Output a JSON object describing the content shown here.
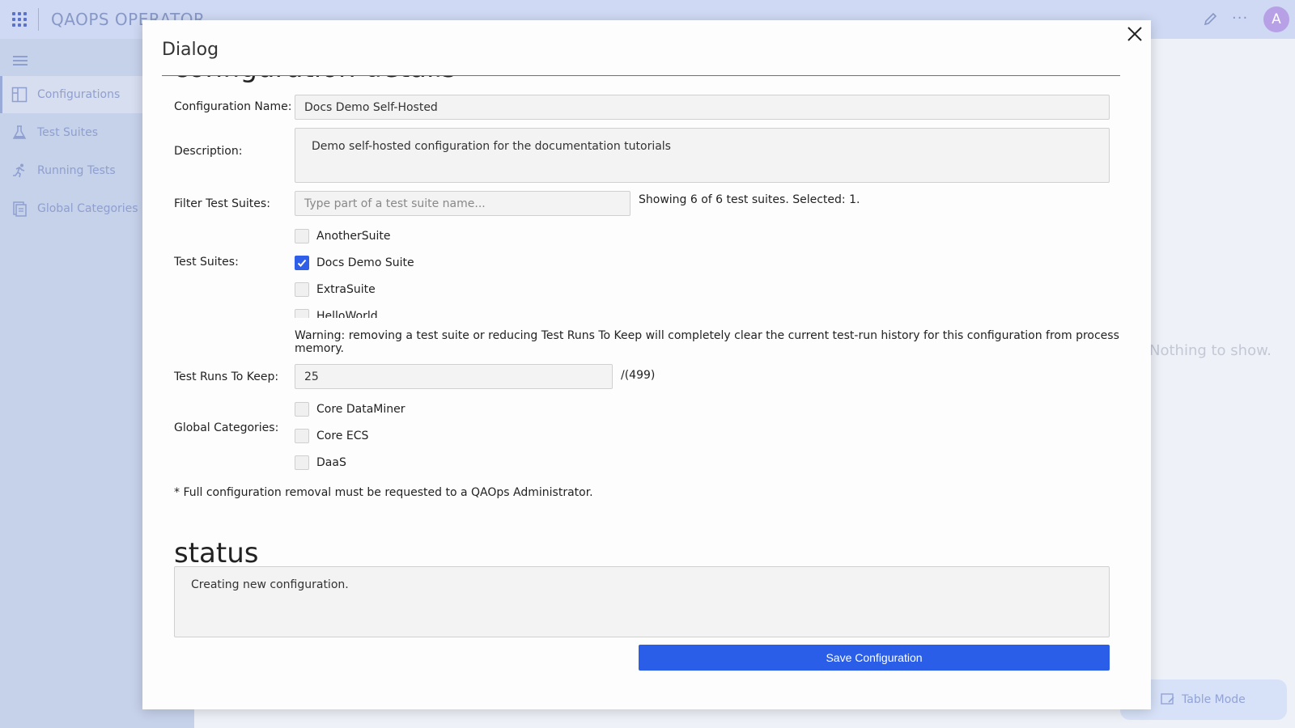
{
  "app": {
    "title": "QAOPS OPERATOR",
    "avatar_letter": "A",
    "more_glyph": "···"
  },
  "sidebar": {
    "items": [
      {
        "label": "Configurations",
        "icon": "layout-icon",
        "active": true
      },
      {
        "label": "Test Suites",
        "icon": "flask-icon",
        "active": false
      },
      {
        "label": "Running Tests",
        "icon": "runner-icon",
        "active": false
      },
      {
        "label": "Global Categories",
        "icon": "document-icon",
        "active": false
      }
    ]
  },
  "main": {
    "empty_text": "Nothing to show.",
    "table_mode_label": "Table Mode"
  },
  "dialog": {
    "title": "Dialog",
    "section_heading": "configuration details",
    "config_name": {
      "label": "Configuration Name:",
      "value": "Docs Demo Self-Hosted"
    },
    "description": {
      "label": "Description:",
      "value": "Demo self-hosted configuration for the documentation tutorials"
    },
    "filter": {
      "label": "Filter Test Suites:",
      "placeholder": "Type part of a test suite name...",
      "info": "Showing 6 of 6 test suites. Selected: 1."
    },
    "test_suites": {
      "label": "Test Suites:",
      "items": [
        {
          "label": "AnotherSuite",
          "checked": false
        },
        {
          "label": "Docs Demo Suite",
          "checked": true
        },
        {
          "label": "ExtraSuite",
          "checked": false
        },
        {
          "label": "HelloWorld",
          "checked": false
        }
      ]
    },
    "warning": "Warning: removing a test suite or reducing Test Runs To Keep will completely clear the current test-run history for this configuration from process memory.",
    "runs_to_keep": {
      "label": "Test Runs To Keep:",
      "value": "25",
      "max": "/(499)"
    },
    "global_categories": {
      "label": "Global Categories:",
      "items": [
        {
          "label": "Core DataMiner",
          "checked": false
        },
        {
          "label": "Core ECS",
          "checked": false
        },
        {
          "label": "DaaS",
          "checked": false
        }
      ]
    },
    "removal_note": "* Full configuration removal must be requested to a QAOps Administrator.",
    "status_heading": "status",
    "status_text": "Creating new configuration.",
    "save_label": "Save Configuration"
  },
  "colors": {
    "accent": "#2a5ee8",
    "sidebar_bg": "#c6d1ea",
    "topbar_bg": "#cfd9f3"
  }
}
